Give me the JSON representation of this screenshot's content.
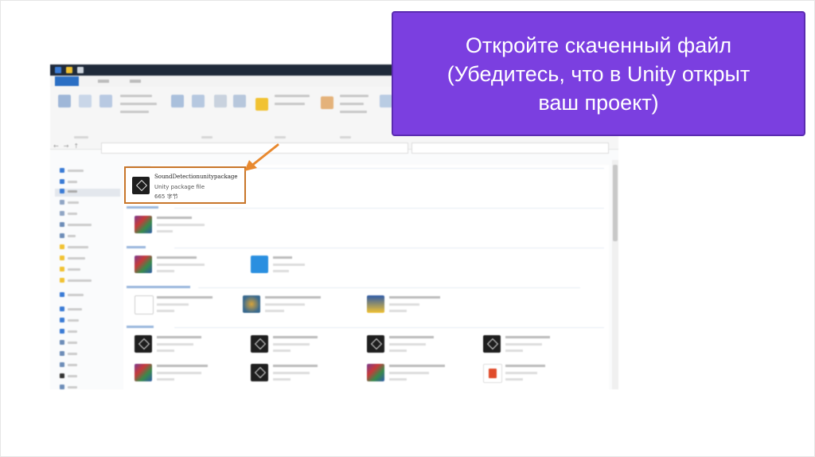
{
  "callout": {
    "line1": "Откройте скаченный файл",
    "line2": "(Убедитесь, что в Unity открыт",
    "line3": "ваш проект)",
    "background": "#7b3fe0"
  },
  "explorer": {
    "highlighted_file": {
      "name": "SoundDetectionunitypackage",
      "type": "Unity package file",
      "size": "665 字节",
      "highlight_color": "#c8762a"
    },
    "icons": {
      "file": "unity-package-icon",
      "arrow": "pointer-arrow-icon"
    }
  }
}
